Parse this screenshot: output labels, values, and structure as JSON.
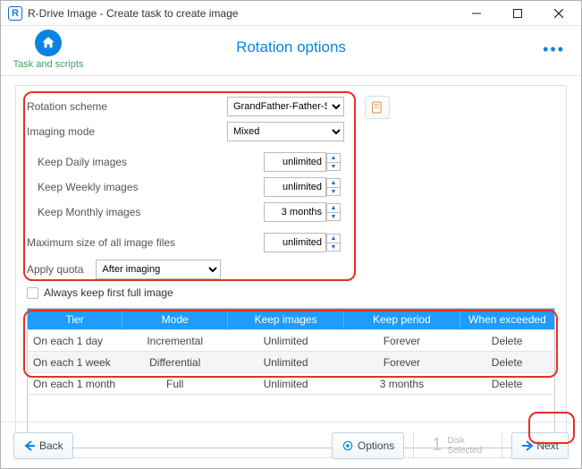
{
  "window": {
    "title": "R-Drive Image - Create task to create image"
  },
  "header": {
    "task_label": "Task and scripts",
    "title": "Rotation options"
  },
  "form": {
    "rotation_scheme_label": "Rotation scheme",
    "rotation_scheme_value": "GrandFather-Father-Son",
    "imaging_mode_label": "Imaging mode",
    "imaging_mode_value": "Mixed",
    "keep_daily_label": "Keep Daily images",
    "keep_daily_value": "unlimited",
    "keep_weekly_label": "Keep Weekly images",
    "keep_weekly_value": "unlimited",
    "keep_monthly_label": "Keep Monthly images",
    "keep_monthly_value": "3 months",
    "max_size_label": "Maximum size of all image files",
    "max_size_value": "unlimited",
    "apply_quota_label": "Apply quota",
    "apply_quota_value": "After imaging",
    "always_keep_label": "Always keep first full image"
  },
  "table": {
    "headers": {
      "tier": "Tier",
      "mode": "Mode",
      "keep_images": "Keep images",
      "keep_period": "Keep period",
      "when_exceeded": "When exceeded"
    },
    "rows": [
      {
        "tier": "On each 1 day",
        "mode": "Incremental",
        "keep_images": "Unlimited",
        "keep_period": "Forever",
        "when_exceeded": "Delete"
      },
      {
        "tier": "On each 1 week",
        "mode": "Differential",
        "keep_images": "Unlimited",
        "keep_period": "Forever",
        "when_exceeded": "Delete"
      },
      {
        "tier": "On each 1 month",
        "mode": "Full",
        "keep_images": "Unlimited",
        "keep_period": "3 months",
        "when_exceeded": "Delete"
      }
    ]
  },
  "footer": {
    "back": "Back",
    "options": "Options",
    "disk_count": "1",
    "disk_l1": "Disk",
    "disk_l2": "Selected",
    "next": "Next"
  }
}
